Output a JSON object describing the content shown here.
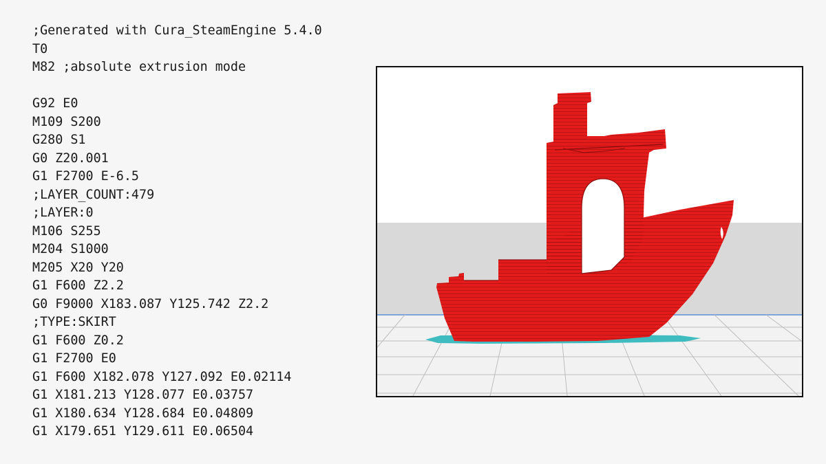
{
  "gcode": {
    "lines": [
      ";Generated with Cura_SteamEngine 5.4.0",
      "T0",
      "M82 ;absolute extrusion mode",
      "",
      "G92 E0",
      "M109 S200",
      "G280 S1",
      "G0 Z20.001",
      "G1 F2700 E-6.5",
      ";LAYER_COUNT:479",
      ";LAYER:0",
      "M106 S255",
      "M204 S1000",
      "M205 X20 Y20",
      "G1 F600 Z2.2",
      "G0 F9000 X183.087 Y125.742 Z2.2",
      ";TYPE:SKIRT",
      "G1 F600 Z0.2",
      "G1 F2700 E0",
      "G1 F600 X182.078 Y127.092 E0.02114",
      "G1 X181.213 Y128.077 E0.03757",
      "G1 X180.634 Y128.684 E0.04809",
      "G1 X179.651 Y129.611 E0.06504"
    ]
  },
  "preview": {
    "model_color": "#e31b1b",
    "skirt_color": "#3fbcc0",
    "backdrop_color": "#d9d9d9",
    "floor_color": "#f2f2f2"
  }
}
